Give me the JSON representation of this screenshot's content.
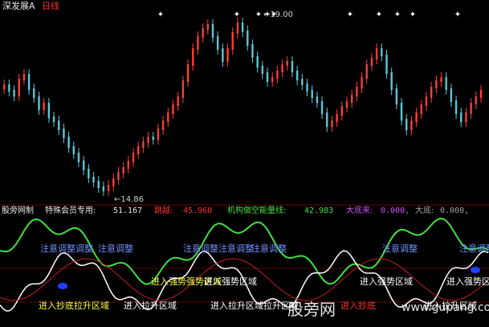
{
  "header": {
    "stock_name": "深发展A",
    "period": "日线",
    "colors": {
      "stock_name": "#e8e8e8",
      "period": "#ff3030"
    }
  },
  "price_panel": {
    "high_label": "←19.00",
    "low_label": "←14.86",
    "star_glyph": "✦",
    "colors": {
      "up": "#ff3c3c",
      "down": "#5cc8d8",
      "label": "#cfcfcf",
      "star": "#ffffff"
    }
  },
  "indicator_panel": {
    "header": {
      "title": "股旁网制",
      "special": "特殊会员专用:",
      "special_value": "51.167",
      "jump": "跳越:",
      "jump_value": "45.960",
      "inst_energy": "机构做空能量线:",
      "inst_value": "42.983",
      "big_bottom": "大底来:",
      "big_bottom_value": "0.000,",
      "bottom": "大底:",
      "bottom_value": "0.000,"
    },
    "labels": {
      "attention": "注意调整",
      "attention_overlap_1": "注意调整调整",
      "attention_overlap_2": "注意调整注意调整",
      "strong_zone": "进入强势区域",
      "strong_zone_overlap": "进入强势强势区域",
      "lift_zone": "进入拉升区域",
      "lift_zone_overlap": "进入拉升区域拉升区域",
      "chase": "进入抄底",
      "chase_ovr": "进入抄底拉升区域"
    },
    "colors": {
      "title": "#e8e8e8",
      "special": "#e8e8e8",
      "jump": "#ff3030",
      "inst": "#40e040",
      "big_bottom": "#d050ff",
      "bottom": "#a0a0a0",
      "attention": "#7090ff",
      "strong_zone": "#ffffff",
      "strong_zone_overlap": "#ffff40",
      "lift_zone": "#ffffff",
      "lift_zone_overlap": "#ff3030",
      "green_line": "#40e040",
      "white_line": "#ffffff",
      "red_line": "#c02020",
      "dot": "#2040ff"
    }
  },
  "watermark": {
    "brand": "股旁网",
    "url": "www.gupang.com",
    "color": "#ffffff"
  }
}
